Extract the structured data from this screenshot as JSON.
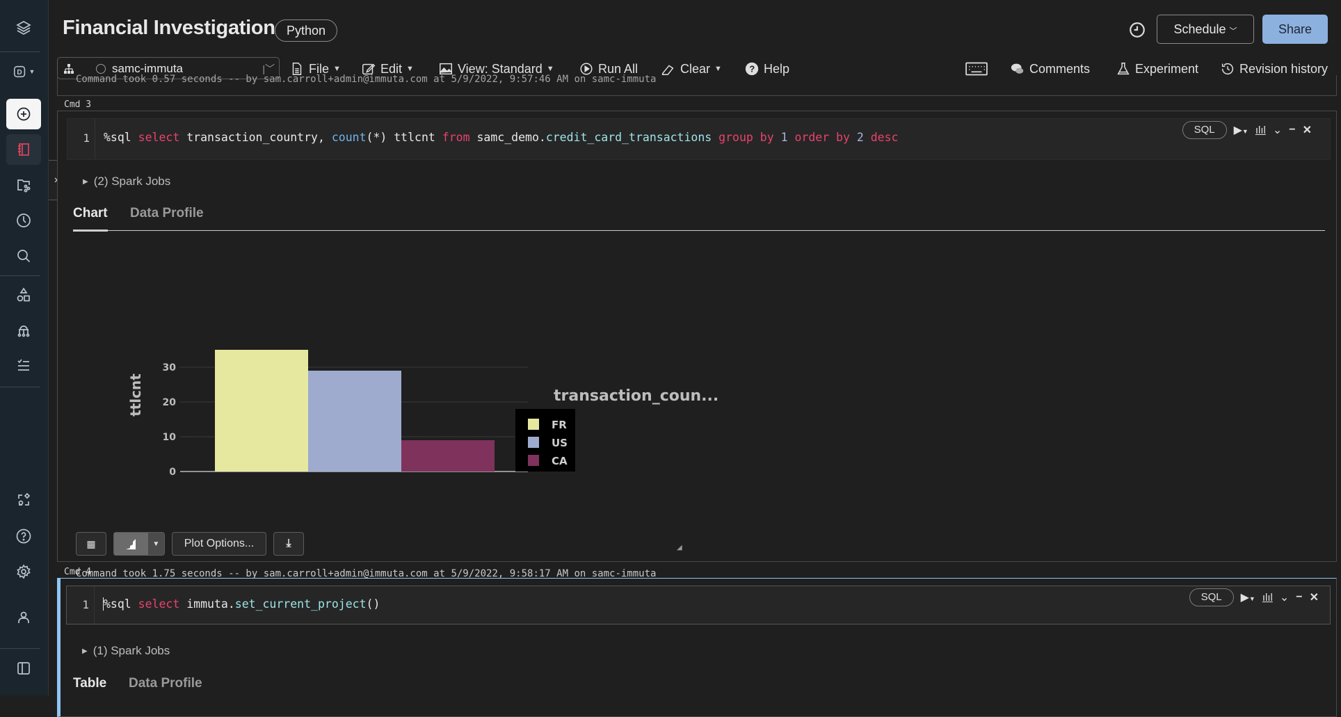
{
  "notebook": {
    "title": "Financial Investigation",
    "language": "Python"
  },
  "header": {
    "schedule_label": "Schedule",
    "share_label": "Share"
  },
  "cluster": {
    "name": "samc-immuta"
  },
  "toolbar": {
    "file": "File",
    "edit": "Edit",
    "view": "View: Standard",
    "run_all": "Run All",
    "clear": "Clear",
    "help": "Help",
    "comments": "Comments",
    "experiment": "Experiment",
    "revision_history": "Revision history"
  },
  "sidebar": {
    "items": [
      {
        "icon": "databricks-logo-icon"
      },
      {
        "icon": "workspace-switcher-icon",
        "label": "D"
      },
      {
        "icon": "create-icon"
      },
      {
        "icon": "notebook-icon"
      },
      {
        "icon": "repos-icon"
      },
      {
        "icon": "recents-icon"
      },
      {
        "icon": "search-icon"
      },
      {
        "icon": "data-icon"
      },
      {
        "icon": "compute-icon"
      },
      {
        "icon": "jobs-icon"
      },
      {
        "icon": "partner-connect-icon"
      },
      {
        "icon": "help-icon"
      },
      {
        "icon": "settings-icon"
      },
      {
        "icon": "account-icon"
      },
      {
        "icon": "collapse-sidebar-icon"
      }
    ]
  },
  "prev_cell": {
    "command_took": "Command took 0.57 seconds -- by sam.carroll+admin@immuta.com at 5/9/2022, 9:57:46 AM on samc-immuta"
  },
  "cells": [
    {
      "label": "Cmd 3",
      "line_number": "1",
      "code_tokens": [
        {
          "t": "%sql ",
          "c": ""
        },
        {
          "t": "select ",
          "c": "kw"
        },
        {
          "t": "transaction_country, ",
          "c": ""
        },
        {
          "t": "count",
          "c": "fn"
        },
        {
          "t": "(*) ttlcnt ",
          "c": ""
        },
        {
          "t": "from ",
          "c": "kw"
        },
        {
          "t": "samc_demo.",
          "c": ""
        },
        {
          "t": "credit_card_transactions ",
          "c": "id"
        },
        {
          "t": "group by ",
          "c": "kw"
        },
        {
          "t": "1 ",
          "c": "num"
        },
        {
          "t": "order by ",
          "c": "kw"
        },
        {
          "t": "2 ",
          "c": "num"
        },
        {
          "t": "desc",
          "c": "kw"
        }
      ],
      "lang_pill": "SQL",
      "spark_jobs": "(2) Spark Jobs",
      "tabs": [
        "Chart",
        "Data Profile"
      ],
      "active_tab": "Chart",
      "plot_options_label": "Plot Options...",
      "command_took": "Command took 1.75 seconds -- by sam.carroll+admin@immuta.com at 5/9/2022, 9:58:17 AM on samc-immuta"
    },
    {
      "label": "Cmd 4",
      "line_number": "1",
      "code_tokens": [
        {
          "t": "%sql ",
          "c": ""
        },
        {
          "t": "select ",
          "c": "kw"
        },
        {
          "t": "immuta.",
          "c": ""
        },
        {
          "t": "set_current_project",
          "c": "id"
        },
        {
          "t": "()",
          "c": ""
        }
      ],
      "lang_pill": "SQL",
      "spark_jobs": "(1) Spark Jobs",
      "tabs": [
        "Table",
        "Data Profile"
      ],
      "active_tab": "Table"
    }
  ],
  "chart_data": {
    "type": "bar",
    "title": "transaction_coun...",
    "xlabel": "",
    "ylabel": "ttlcnt",
    "categories": [
      "FR",
      "US",
      "CA"
    ],
    "values": [
      35,
      29,
      9
    ],
    "colors": [
      "#e6e8a0",
      "#9eabce",
      "#7e325c"
    ],
    "yticks": [
      0,
      10,
      20,
      30
    ],
    "ylim": [
      0,
      36
    ],
    "grid": true,
    "legend": {
      "title": "transaction_coun...",
      "entries": [
        "FR",
        "US",
        "CA"
      ],
      "position": "right"
    }
  }
}
